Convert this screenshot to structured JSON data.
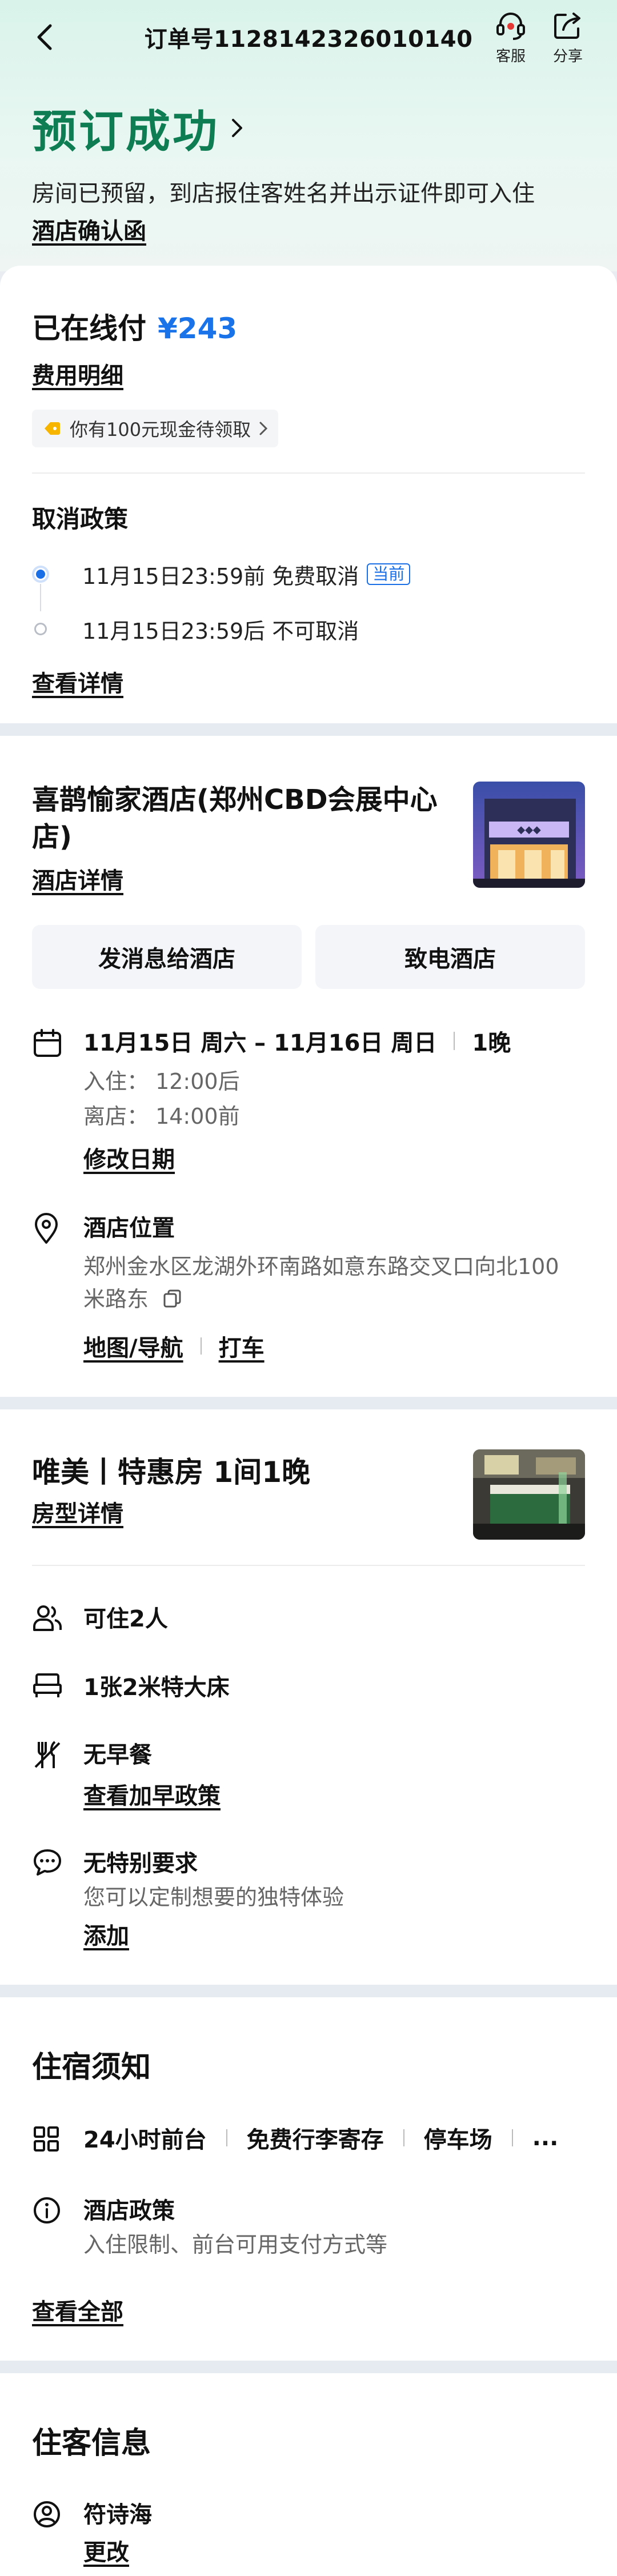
{
  "header": {
    "order_number": "订单号1128142326010140",
    "service_label": "客服",
    "share_label": "分享"
  },
  "hero": {
    "title": "预订成功",
    "description": "房间已预留，到店报住客姓名并出示证件即可入住",
    "confirm_letter": "酒店确认函"
  },
  "payment": {
    "label": "已在线付",
    "amount": "¥243",
    "fee_detail": "费用明细",
    "coupon": "你有100元现金待领取",
    "accent_color": "#1a73e8"
  },
  "cancel_policy": {
    "title": "取消政策",
    "items": [
      {
        "text": "11月15日23:59前 免费取消",
        "badge": "当前"
      },
      {
        "text": "11月15日23:59后 不可取消"
      }
    ],
    "see_detail": "查看详情"
  },
  "hotel": {
    "name": "喜鹊愉家酒店(郑州CBD会展中心店)",
    "detail_link": "酒店详情",
    "message_button": "发消息给酒店",
    "call_button": "致电酒店",
    "dates": "11月15日 周六 – 11月16日 周日",
    "nights": "1晚",
    "checkin": "入住：  12:00后",
    "checkout": "离店：  14:00前",
    "modify_date": "修改日期",
    "location_title": "酒店位置",
    "address": "郑州金水区龙湖外环南路如意东路交叉口向北100米路东",
    "map_nav": "地图/导航",
    "taxi": "打车"
  },
  "room": {
    "title": "唯美丨特惠房  1间1晚",
    "detail_link": "房型详情",
    "features": [
      {
        "icon": "people-icon",
        "main": "可住2人"
      },
      {
        "icon": "bed-icon",
        "main": "1张2米特大床"
      },
      {
        "icon": "no-breakfast-icon",
        "main": "无早餐",
        "link": "查看加早政策"
      },
      {
        "icon": "chat-icon",
        "main": "无特别要求",
        "sub": "您可以定制想要的独特体验",
        "link": "添加"
      }
    ]
  },
  "notice": {
    "title": "住宿须知",
    "facilities": [
      "24小时前台",
      "免费行李寄存",
      "停车场",
      "..."
    ],
    "policy_title": "酒店政策",
    "policy_sub": "入住限制、前台可用支付方式等",
    "see_all": "查看全部"
  },
  "guest": {
    "title": "住客信息",
    "name": "符诗海",
    "change": "更改"
  },
  "colors": {
    "brand_green": "#0f7d54",
    "price_blue": "#1a73e8",
    "current_blue": "#1a6fe6"
  }
}
